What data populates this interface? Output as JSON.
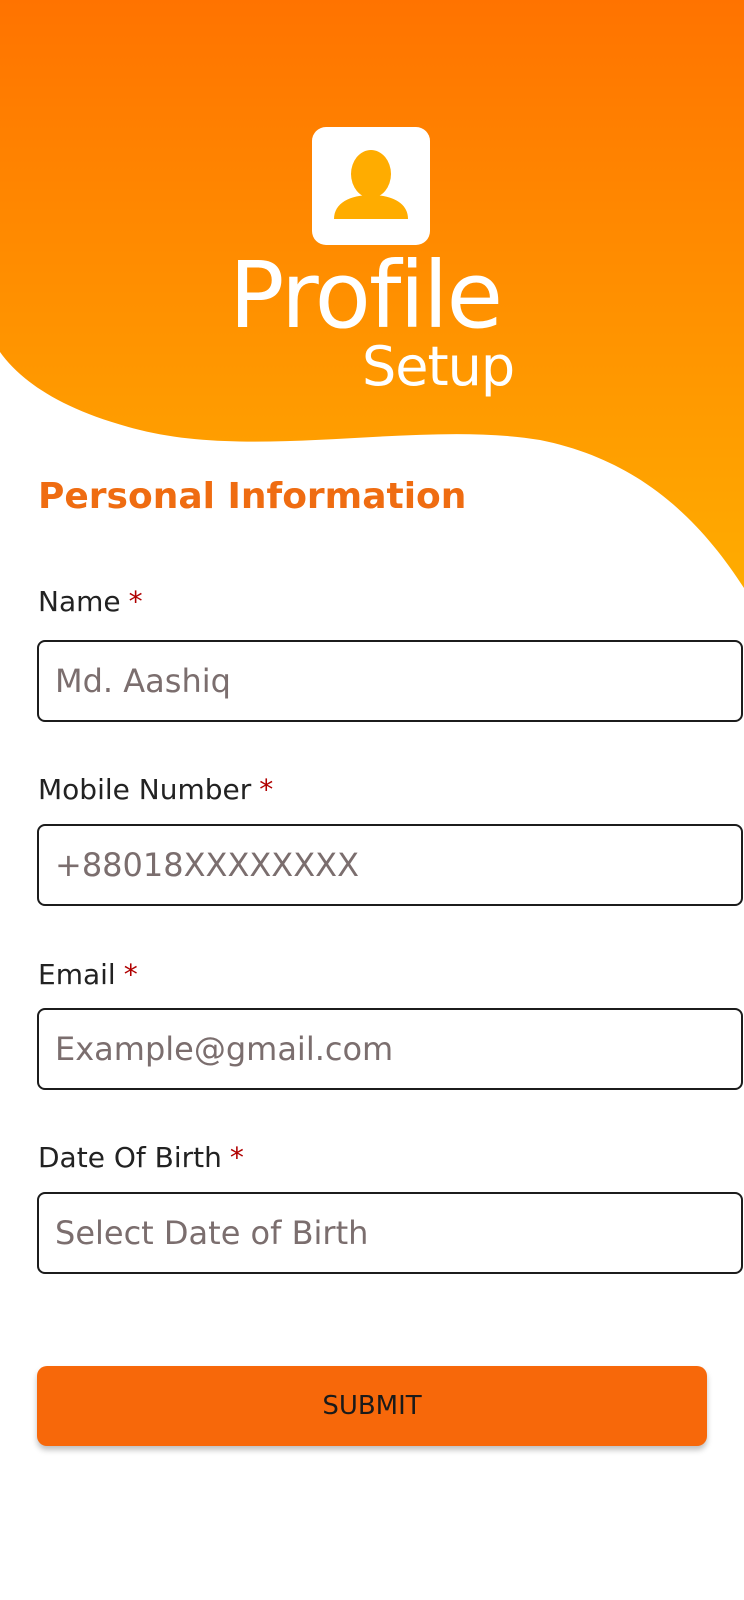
{
  "header": {
    "brand_title": "Profile",
    "brand_subtitle": "Setup",
    "avatar_icon": "user-avatar-icon"
  },
  "form": {
    "section_title": "Personal Information",
    "required_marker": "*",
    "fields": [
      {
        "label": "Name",
        "value": "Md. Aashiq",
        "placeholder": "Md. Aashiq"
      },
      {
        "label": "Mobile Number",
        "value": "+88018XXXXXXXX",
        "placeholder": "+88018XXXXXXXX"
      },
      {
        "label": "Email",
        "value": "Example@gmail.com",
        "placeholder": "Example@gmail.com"
      },
      {
        "label": "Date Of Birth",
        "value": "Select Date of Birth",
        "placeholder": "Select Date of Birth"
      }
    ],
    "submit_label": "SUBMIT"
  },
  "colors": {
    "header_gradient_top": "#ff7300",
    "header_gradient_bottom": "#ffac00",
    "accent": "#ef6c11",
    "button": "#f7680a",
    "required": "#b00000",
    "placeholder_text": "#7b6e6e"
  }
}
